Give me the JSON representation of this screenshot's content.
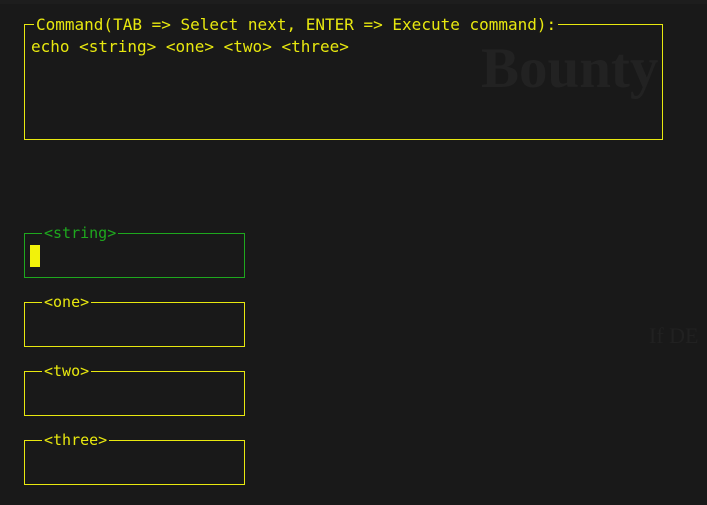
{
  "theme": {
    "background": "#191919",
    "accent_yellow": "#e8e80f",
    "accent_green": "#1ea81e",
    "cursor_yellow": "#f2f20a",
    "faint_text": "#222222"
  },
  "background_page": {
    "heading": "Bounty",
    "paragraph": "If DE"
  },
  "command_panel": {
    "label": "Command(TAB => Select next, ENTER => Execute command):",
    "command_text": "echo <string> <one> <two> <three>"
  },
  "fields": [
    {
      "name": "string",
      "label": "<string>",
      "value": "",
      "placeholder": "",
      "active": true,
      "cursor_visible": true
    },
    {
      "name": "one",
      "label": "<one>",
      "value": "",
      "placeholder": "",
      "active": false,
      "cursor_visible": false
    },
    {
      "name": "two",
      "label": "<two>",
      "value": "",
      "placeholder": "",
      "active": false,
      "cursor_visible": false
    },
    {
      "name": "three",
      "label": "<three>",
      "value": "",
      "placeholder": "",
      "active": false,
      "cursor_visible": false
    }
  ]
}
